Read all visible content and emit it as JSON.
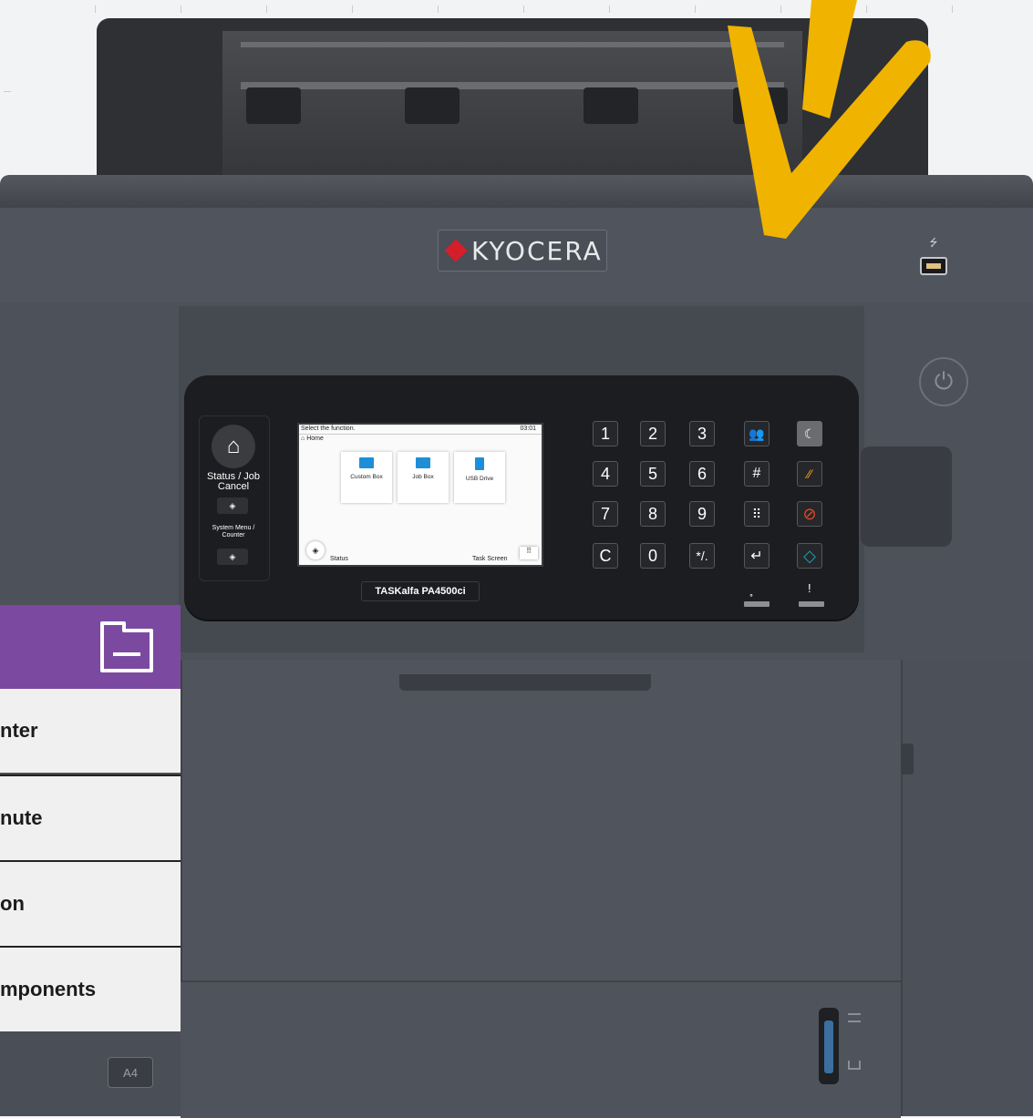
{
  "brand": "KYOCERA",
  "model": "TASKalfa PA4500ci",
  "paper_size_badge": "A4",
  "panel": {
    "home_label": "Status /\nJob Cancel",
    "status_job_cancel": "Status / Job Cancel",
    "system_menu_counter": "System Menu / Counter",
    "screen": {
      "prompt": "Select the function.",
      "time": "03:01",
      "breadcrumb": "Home",
      "tiles": [
        "Custom Box",
        "Job Box",
        "USB Drive"
      ],
      "status": "Status",
      "task_screen": "Task Screen"
    },
    "keypad": [
      "1",
      "2",
      "3",
      "4",
      "5",
      "6",
      "7",
      "8",
      "9",
      "C",
      "0",
      "*/."
    ],
    "special_keys": [
      "user-login",
      "sleep",
      "hash",
      "interrupt",
      "grid-menu",
      "stop",
      "enter",
      "start"
    ],
    "led_labels": [
      "̥",
      "!"
    ]
  },
  "menu": {
    "items": [
      "nter",
      "nute",
      "on",
      "mponents"
    ]
  },
  "colors": {
    "accent_purple": "#7b4aa0",
    "check_yellow": "#f0b400",
    "brand_red": "#d41f2b",
    "stop_red": "#e8472a",
    "start_teal": "#1fa0b8",
    "interrupt_orange": "#f0a020"
  },
  "icons": {
    "menu_header": "printer-icon",
    "home": "home-icon",
    "power": "power-icon",
    "usb": "usb-icon"
  }
}
